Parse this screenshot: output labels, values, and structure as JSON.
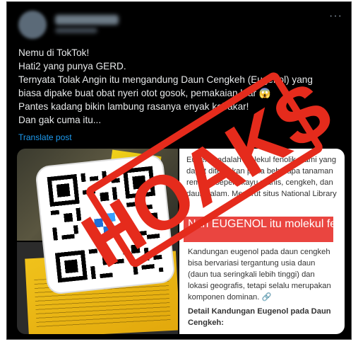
{
  "header": {
    "more_label": "···"
  },
  "post": {
    "lines": [
      "Nemu di TokTok!",
      "Hati2 yang punya GERD.",
      "Ternyata Tolak Angin itu mengandung Daun Cengkeh (Eugenol) yang",
      "biasa dipake buat obat nyeri otot gosok, pemakaian luar 😱",
      "Pantes kadang bikin lambung rasanya enyak kebakar!",
      "Dan gak cuma itu..."
    ],
    "translate_label": "Translate post"
  },
  "media": {
    "top_right_text": "Eugenol adalah molekul fenolik alami yang dapat ditemukan pada beberapa tanaman rempah seperti kayu manis, cengkeh, dan daun salam. Menurut situs National Library",
    "highlight_text": "Nah EUGENOL itu molekul fenolik ditemukan di",
    "bottom_right_text": "Kandungan eugenol pada daun cengkeh bisa bervariasi tergantung usia daun (daun tua seringkali lebih tinggi) dan lokasi geografis, tetapi selalu merupakan komponen dominan. 🔗",
    "bottom_right_heading": "Detail Kandungan Eugenol pada Daun Cengkeh:"
  },
  "stamp": {
    "text": "HOAKS",
    "color": "#e52b1c"
  },
  "colors": {
    "background": "#000000",
    "text": "#e7e9ea",
    "link": "#1d9bf0"
  }
}
